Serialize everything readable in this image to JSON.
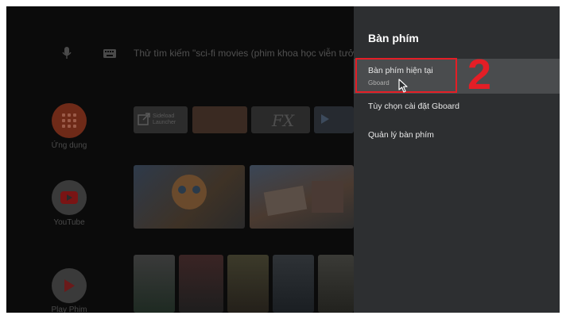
{
  "launcher": {
    "search_placeholder": "Thử tìm kiếm \"sci-fi movies (phim khoa học viễn tưởng)\"",
    "apps": [
      {
        "label": "Ứng dụng",
        "color": "#7a2a16"
      },
      {
        "label": "YouTube",
        "color": "#7a1414"
      },
      {
        "label": "Play Phim",
        "color": "#5a1a1a"
      }
    ],
    "tile_texts": {
      "sideload": "Sideload Launcher",
      "fx": "FX"
    },
    "icons": [
      "microphone-icon",
      "keyboard-icon",
      "grid-icon",
      "play-icon"
    ]
  },
  "panel": {
    "title": "Bàn phím",
    "items": [
      {
        "label": "Bàn phím hiện tại",
        "sub": "Gboard"
      },
      {
        "label": "Tùy chọn cài đặt Gboard"
      },
      {
        "label": "Quản lý bàn phím"
      }
    ],
    "accent_color": "#e41e26",
    "step_number": "2"
  }
}
